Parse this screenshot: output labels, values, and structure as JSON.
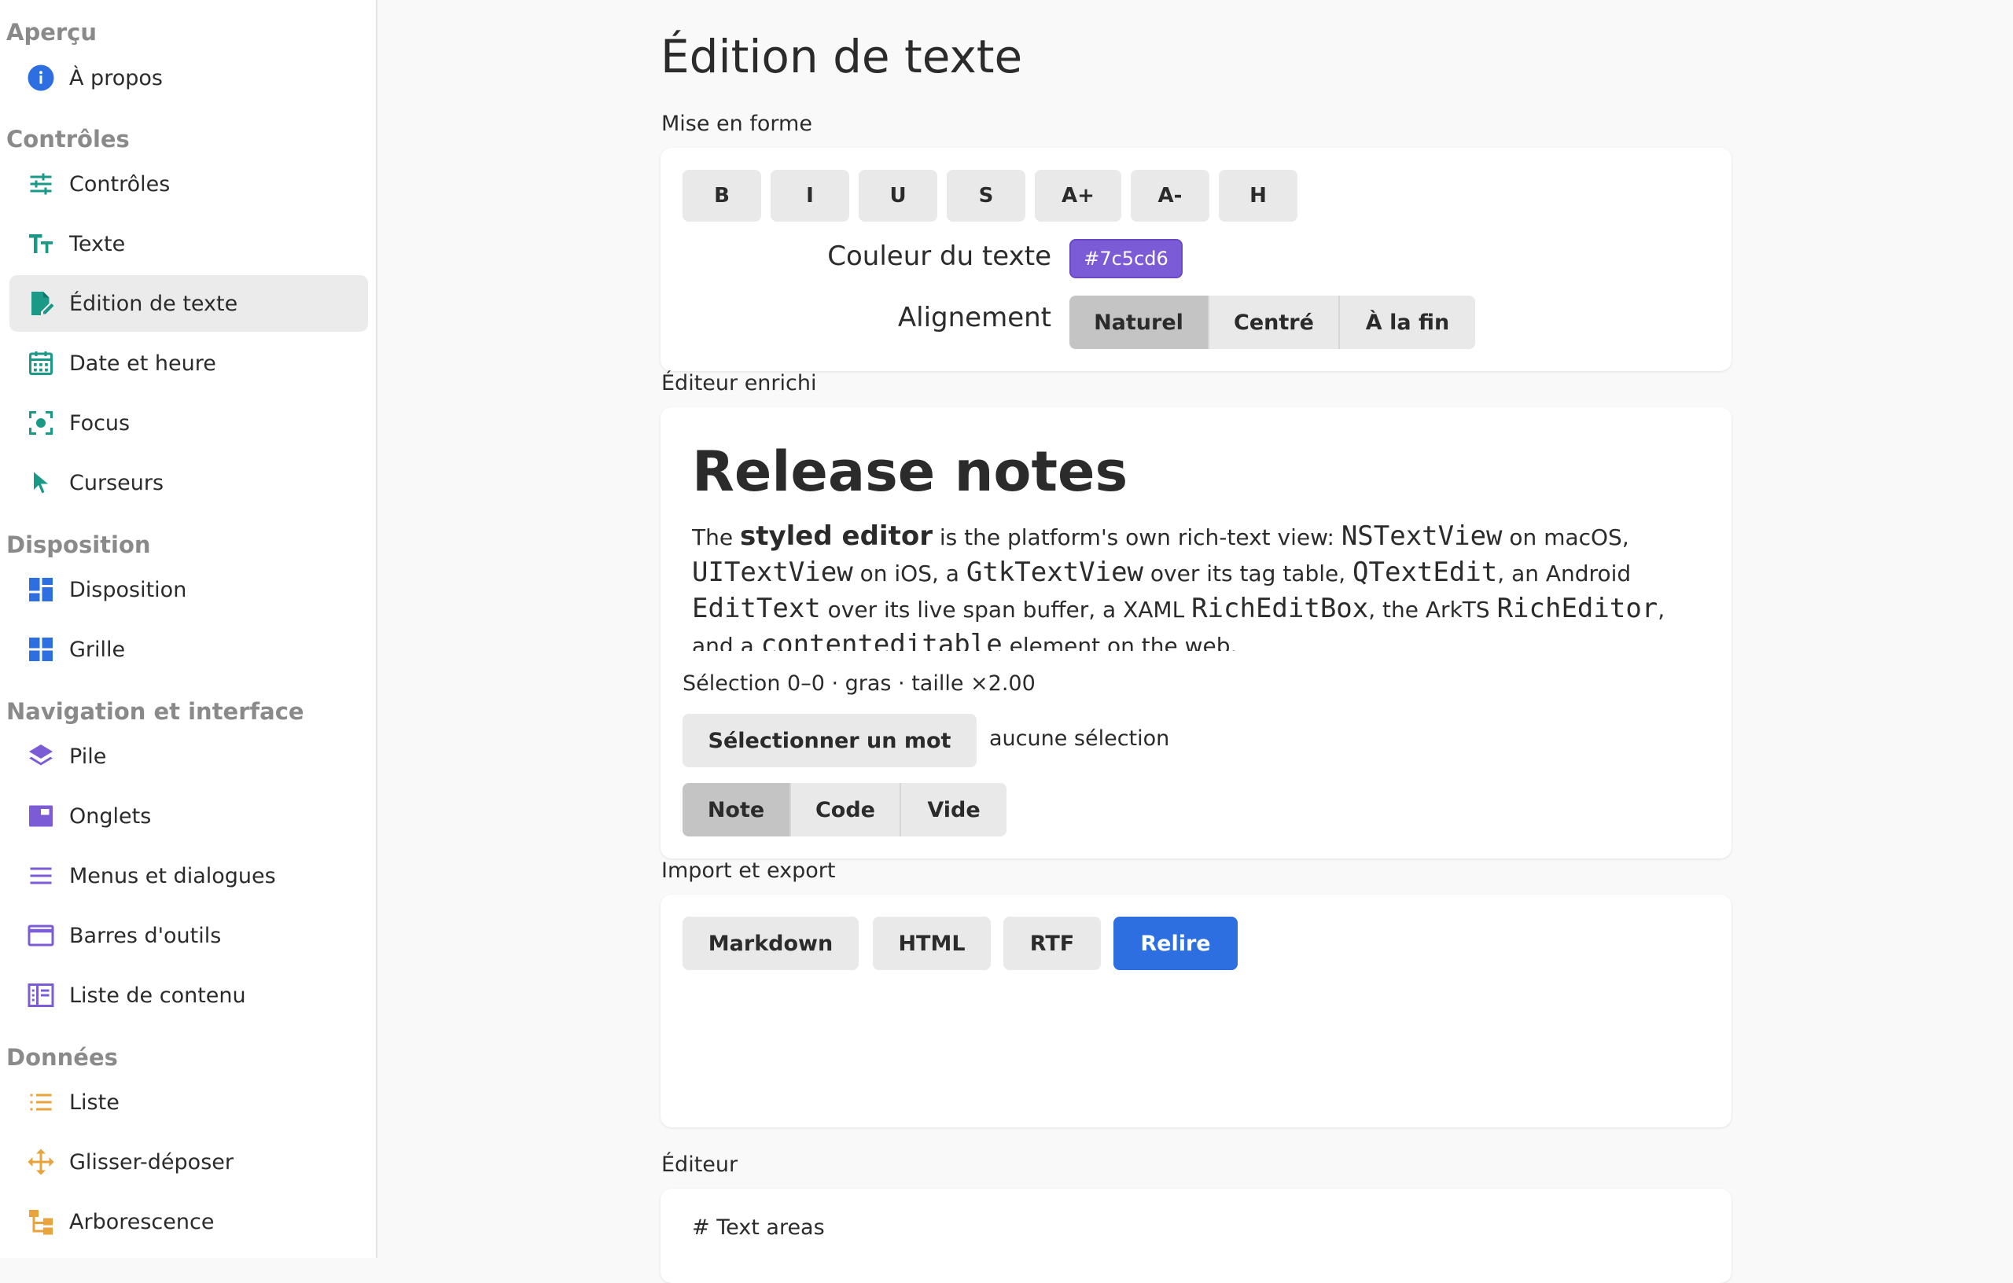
{
  "sidebar": {
    "sections": [
      {
        "title": "Aperçu",
        "items": [
          {
            "label": "À propos",
            "icon": "info-icon"
          }
        ]
      },
      {
        "title": "Contrôles",
        "items": [
          {
            "label": "Contrôles",
            "icon": "sliders-icon"
          },
          {
            "label": "Texte",
            "icon": "text-size-icon"
          },
          {
            "label": "Édition de texte",
            "icon": "edit-document-icon",
            "selected": true
          },
          {
            "label": "Date et heure",
            "icon": "calendar-icon"
          },
          {
            "label": "Focus",
            "icon": "focus-icon"
          },
          {
            "label": "Curseurs",
            "icon": "pointer-icon"
          }
        ]
      },
      {
        "title": "Disposition",
        "items": [
          {
            "label": "Disposition",
            "icon": "dashboard-icon"
          },
          {
            "label": "Grille",
            "icon": "grid-icon"
          }
        ]
      },
      {
        "title": "Navigation et interface",
        "items": [
          {
            "label": "Pile",
            "icon": "layers-icon"
          },
          {
            "label": "Onglets",
            "icon": "tabs-icon"
          },
          {
            "label": "Menus et dialogues",
            "icon": "menu-icon"
          },
          {
            "label": "Barres d'outils",
            "icon": "window-icon"
          },
          {
            "label": "Liste de contenu",
            "icon": "split-view-icon"
          }
        ]
      },
      {
        "title": "Données",
        "items": [
          {
            "label": "Liste",
            "icon": "list-icon"
          },
          {
            "label": "Glisser-déposer",
            "icon": "move-icon"
          },
          {
            "label": "Arborescence",
            "icon": "tree-icon"
          }
        ]
      }
    ],
    "colors": {
      "blue": "#2d6fe0",
      "teal": "#1a9a86",
      "purple": "#7c5cd6",
      "orange": "#e8a33c"
    }
  },
  "main": {
    "title": "Édition de texte",
    "formatting": {
      "label": "Mise en forme",
      "buttons": [
        "B",
        "I",
        "U",
        "S",
        "A+",
        "A-",
        "H"
      ],
      "color_label": "Couleur du texte",
      "color_value": "#7c5cd6",
      "align_label": "Alignement",
      "align_options": [
        "Naturel",
        "Centré",
        "À la fin"
      ],
      "align_selected": "Naturel"
    },
    "rich": {
      "label": "Éditeur enrichi",
      "heading": "Release notes",
      "body": {
        "t1": "The ",
        "b1": "styled editor",
        "t2": " is the platform's own rich-text view: ",
        "m1": "NSTextView",
        "t3": " on macOS, ",
        "m2": "UITextView",
        "t4": " on iOS, a ",
        "m3": "GtkTextView",
        "t5": " over its tag table, ",
        "m4": "QTextEdit",
        "t6": ", an Android ",
        "m5": "EditText",
        "t7": " over its live span buffer, a XAML ",
        "m6": "RichEditBox",
        "t8": ", the ArkTS ",
        "m7": "RichEditor",
        "t9": ", and a ",
        "m8": "contenteditable",
        "t10": " element on the web."
      },
      "selection_status": "Sélection 0–0 · gras · taille ×2.00",
      "select_word_button": "Sélectionner un mot",
      "no_selection": "aucune sélection",
      "presets": [
        "Note",
        "Code",
        "Vide"
      ],
      "preset_selected": "Note"
    },
    "import_export": {
      "label": "Import et export",
      "buttons": [
        "Markdown",
        "HTML",
        "RTF"
      ],
      "primary_button": "Relire"
    },
    "editor": {
      "label": "Éditeur",
      "content": "# Text areas"
    }
  }
}
